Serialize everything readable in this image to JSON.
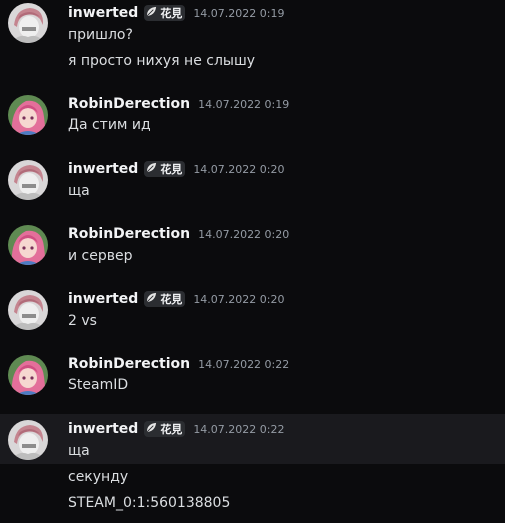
{
  "messages": [
    {
      "author": "inwerted",
      "tag": "花見",
      "timestamp": "14.07.2022 0:19",
      "lines": [
        "пришло?",
        "я просто нихуя не слышу"
      ]
    },
    {
      "author": "RobinDerection",
      "timestamp": "14.07.2022 0:19",
      "lines": [
        "Да стим ид"
      ]
    },
    {
      "author": "inwerted",
      "tag": "花見",
      "timestamp": "14.07.2022 0:20",
      "lines": [
        "ща"
      ]
    },
    {
      "author": "RobinDerection",
      "timestamp": "14.07.2022 0:20",
      "lines": [
        "и сервер"
      ]
    },
    {
      "author": "inwerted",
      "tag": "花見",
      "timestamp": "14.07.2022 0:20",
      "lines": [
        "2 vs"
      ]
    },
    {
      "author": "RobinDerection",
      "timestamp": "14.07.2022 0:22",
      "lines": [
        "SteamID"
      ]
    },
    {
      "author": "inwerted",
      "tag": "花見",
      "timestamp": "14.07.2022 0:22",
      "lines": [
        "ща",
        "секунду",
        "STEAM_0:1:560138805"
      ]
    }
  ],
  "colors": {
    "background": "#0b0b0d",
    "hover_row": "#1a1a1e",
    "username": "#f2f3f5",
    "text": "#dbdee1",
    "timestamp": "#949ba4",
    "tag_bg": "#2b2d31"
  },
  "icons": {
    "tag_icon": "leaf-icon",
    "avatar_inwerted": "grey-anime-avatar",
    "avatar_robin": "pink-hair-anime-avatar"
  }
}
